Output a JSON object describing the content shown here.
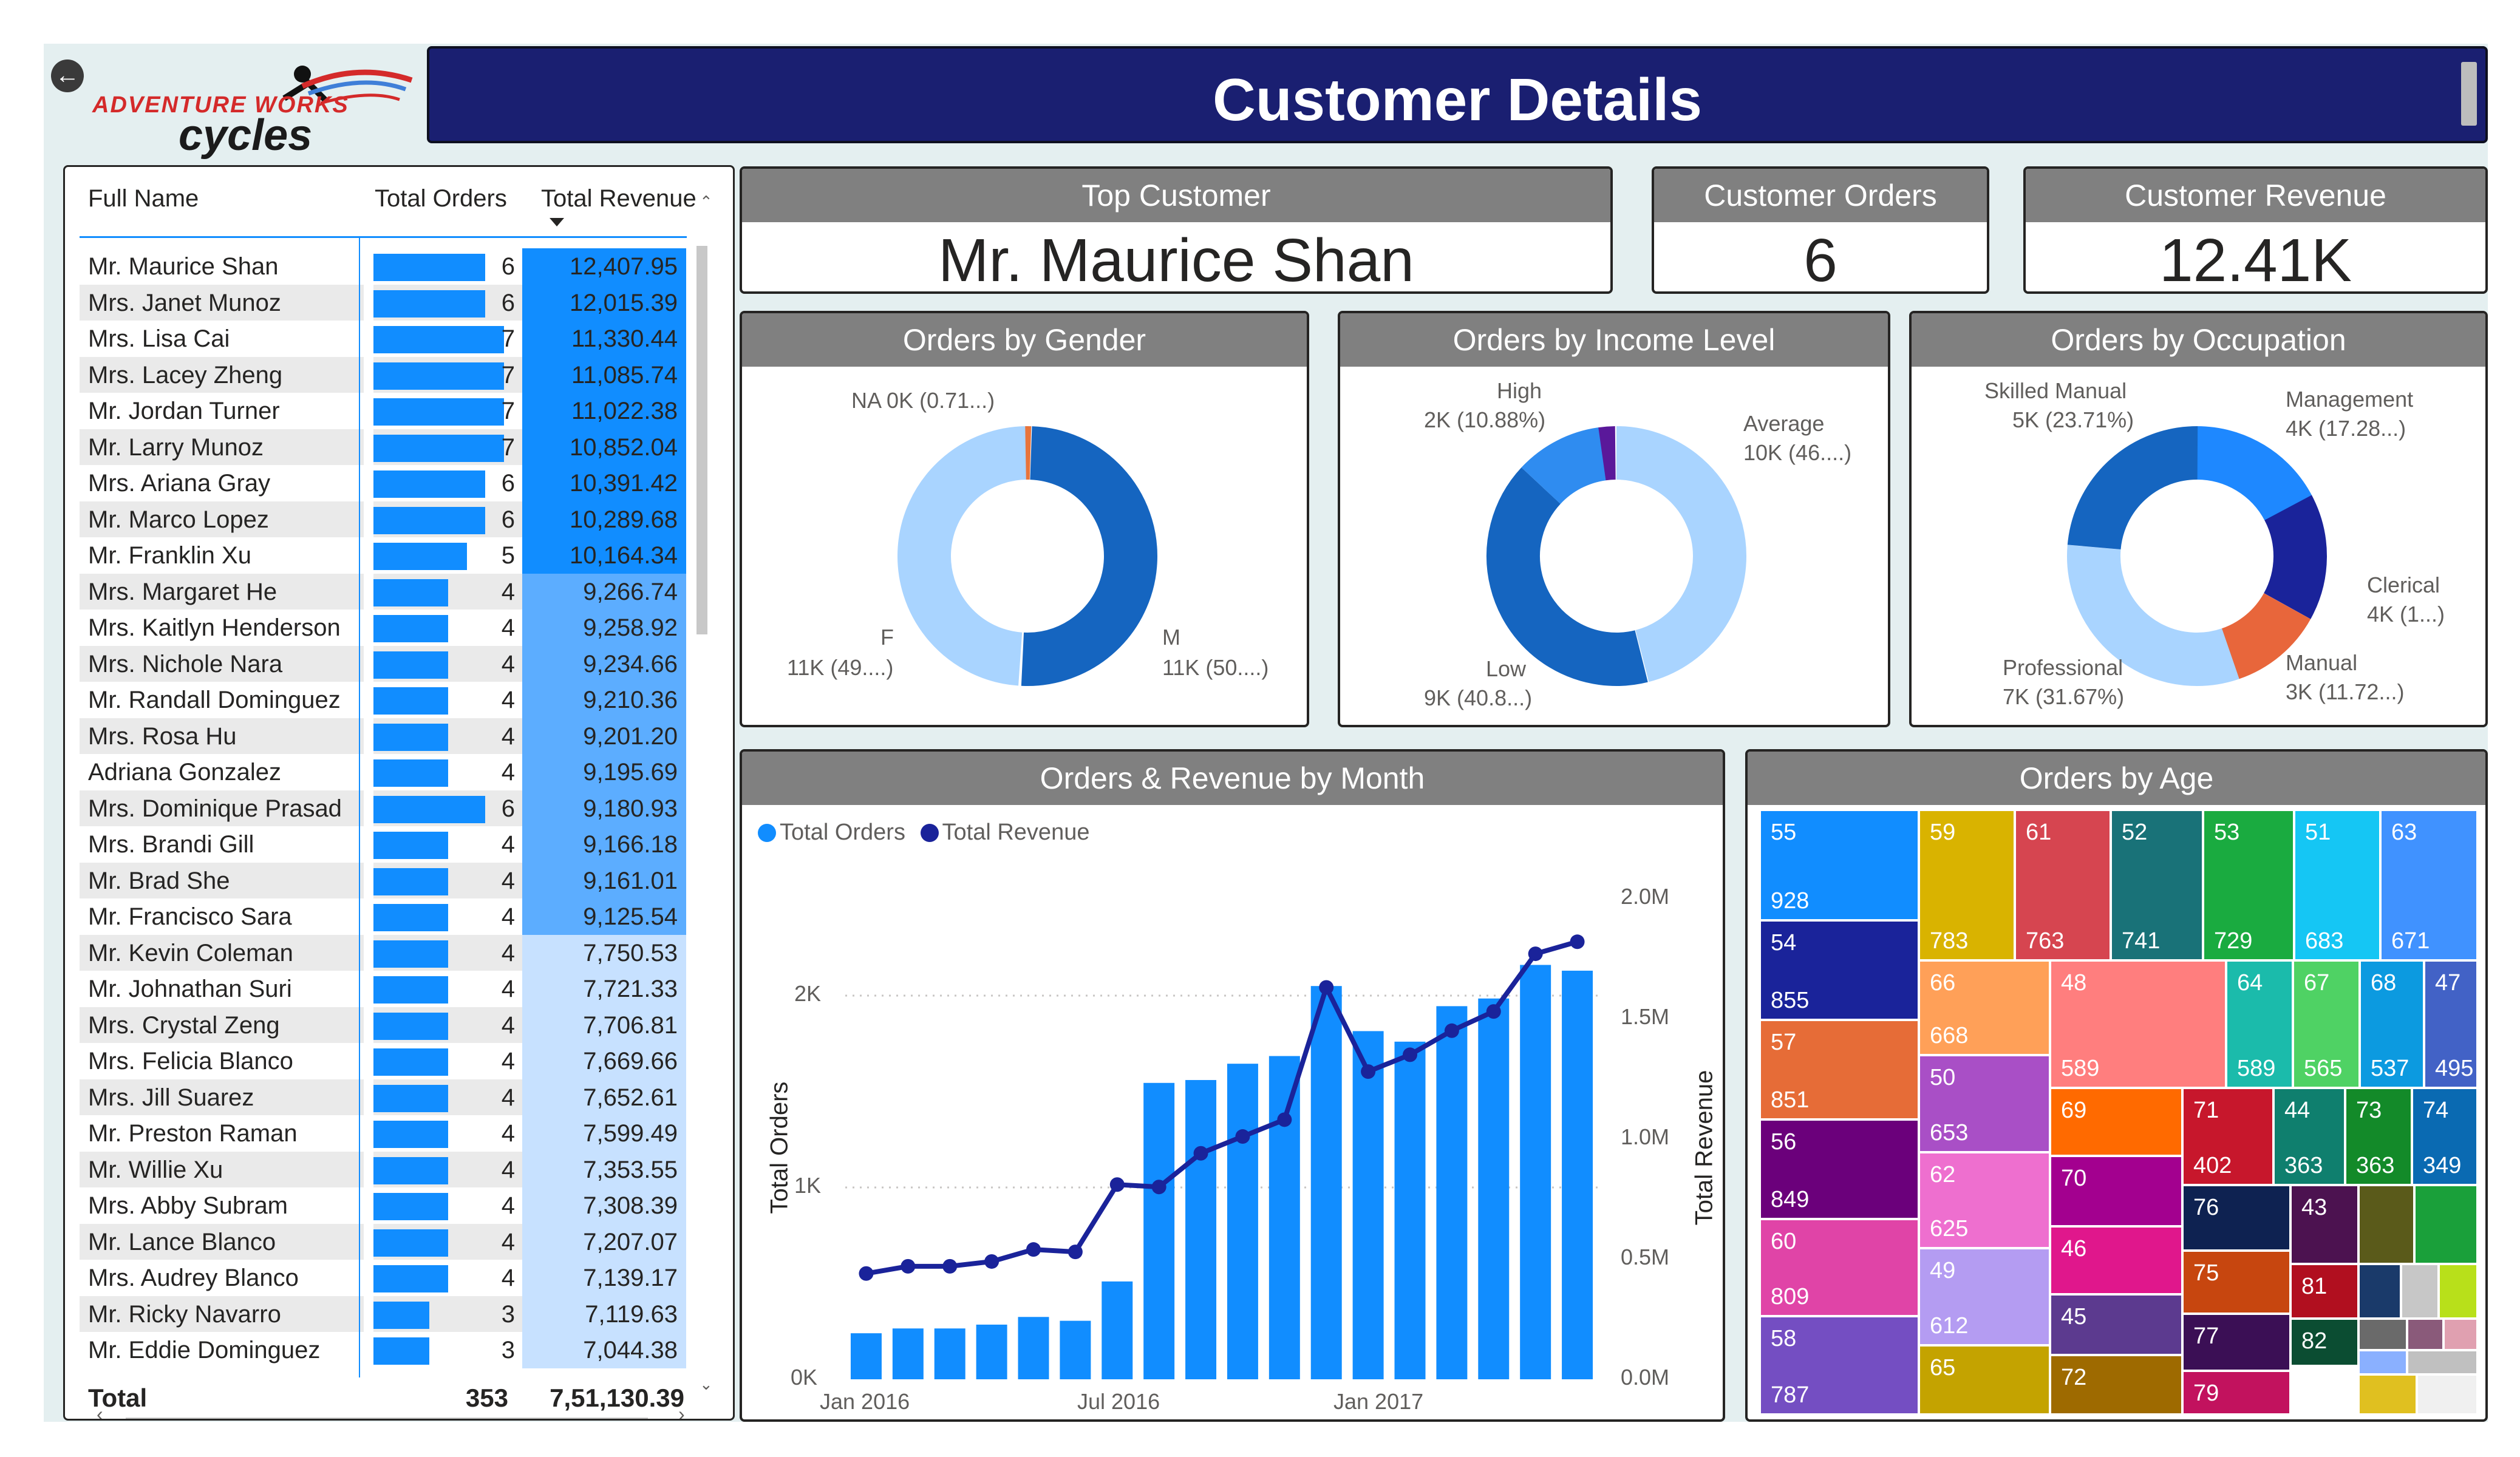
{
  "header": {
    "title": "Customer Details",
    "logo_small": "ADVENTURE WORKS",
    "logo_big": "cycles"
  },
  "table": {
    "columns": [
      "Full Name",
      "Total Orders",
      "Total Revenue"
    ],
    "rows": [
      {
        "name": "Mr. Maurice Shan",
        "orders": "6",
        "revenue": "12,407.95"
      },
      {
        "name": "Mrs. Janet Munoz",
        "orders": "6",
        "revenue": "12,015.39"
      },
      {
        "name": "Mrs. Lisa Cai",
        "orders": "7",
        "revenue": "11,330.44"
      },
      {
        "name": "Mrs. Lacey Zheng",
        "orders": "7",
        "revenue": "11,085.74"
      },
      {
        "name": "Mr. Jordan Turner",
        "orders": "7",
        "revenue": "11,022.38"
      },
      {
        "name": "Mr. Larry Munoz",
        "orders": "7",
        "revenue": "10,852.04"
      },
      {
        "name": "Mrs. Ariana Gray",
        "orders": "6",
        "revenue": "10,391.42"
      },
      {
        "name": "Mr. Marco Lopez",
        "orders": "6",
        "revenue": "10,289.68"
      },
      {
        "name": "Mr. Franklin Xu",
        "orders": "5",
        "revenue": "10,164.34"
      },
      {
        "name": "Mrs. Margaret He",
        "orders": "4",
        "revenue": "9,266.74"
      },
      {
        "name": "Mrs. Kaitlyn Henderson",
        "orders": "4",
        "revenue": "9,258.92"
      },
      {
        "name": "Mrs. Nichole Nara",
        "orders": "4",
        "revenue": "9,234.66"
      },
      {
        "name": "Mr. Randall Dominguez",
        "orders": "4",
        "revenue": "9,210.36"
      },
      {
        "name": "Mrs. Rosa Hu",
        "orders": "4",
        "revenue": "9,201.20"
      },
      {
        "name": "Adriana Gonzalez",
        "orders": "4",
        "revenue": "9,195.69"
      },
      {
        "name": "Mrs. Dominique Prasad",
        "orders": "6",
        "revenue": "9,180.93"
      },
      {
        "name": "Mrs. Brandi Gill",
        "orders": "4",
        "revenue": "9,166.18"
      },
      {
        "name": "Mr. Brad She",
        "orders": "4",
        "revenue": "9,161.01"
      },
      {
        "name": "Mr. Francisco Sara",
        "orders": "4",
        "revenue": "9,125.54"
      },
      {
        "name": "Mr. Kevin Coleman",
        "orders": "4",
        "revenue": "7,750.53"
      },
      {
        "name": "Mr. Johnathan Suri",
        "orders": "4",
        "revenue": "7,721.33"
      },
      {
        "name": "Mrs. Crystal Zeng",
        "orders": "4",
        "revenue": "7,706.81"
      },
      {
        "name": "Mrs. Felicia Blanco",
        "orders": "4",
        "revenue": "7,669.66"
      },
      {
        "name": "Mrs. Jill Suarez",
        "orders": "4",
        "revenue": "7,652.61"
      },
      {
        "name": "Mr. Preston Raman",
        "orders": "4",
        "revenue": "7,599.49"
      },
      {
        "name": "Mr. Willie Xu",
        "orders": "4",
        "revenue": "7,353.55"
      },
      {
        "name": "Mrs. Abby Subram",
        "orders": "4",
        "revenue": "7,308.39"
      },
      {
        "name": "Mr. Lance Blanco",
        "orders": "4",
        "revenue": "7,207.07"
      },
      {
        "name": "Mrs. Audrey Blanco",
        "orders": "4",
        "revenue": "7,139.17"
      },
      {
        "name": "Mr. Ricky Navarro",
        "orders": "3",
        "revenue": "7,119.63"
      },
      {
        "name": "Mr. Eddie Dominguez",
        "orders": "3",
        "revenue": "7,044.38"
      }
    ],
    "total_label": "Total",
    "total_orders": "353",
    "total_revenue": "7,51,130.39"
  },
  "kpis": {
    "top_customer": {
      "label": "Top Customer",
      "value": "Mr. Maurice Shan"
    },
    "orders": {
      "label": "Customer Orders",
      "value": "6"
    },
    "revenue": {
      "label": "Customer Revenue",
      "value": "12.41K"
    }
  },
  "gender": {
    "title": "Orders by Gender",
    "labels": {
      "na_name": "NA",
      "na_value": "0K (0.71...)",
      "f_name": "F",
      "f_value": "11K (49....)",
      "m_name": "M",
      "m_value": "11K (50....)"
    },
    "colors": {
      "M": "#1565c0",
      "F": "#a9d4ff",
      "NA": "#e8743b"
    }
  },
  "income": {
    "title": "Orders by Income Level",
    "labels": {
      "high_name": "High",
      "high_value": "2K (10.88%)",
      "avg_name": "Average",
      "avg_value": "10K (46....)",
      "low_name": "Low",
      "low_value": "9K (40.8...)"
    },
    "colors": {
      "Average": "#a9d4ff",
      "Low": "#1565c0",
      "High": "#2f8cf0",
      "Other": "#5a189a"
    }
  },
  "occupation": {
    "title": "Orders by Occupation",
    "labels": {
      "skilled_name": "Skilled Manual",
      "skilled_value": "5K (23.71%)",
      "mgmt_name": "Management",
      "mgmt_value": "4K (17.28...)",
      "cler_name": "Clerical",
      "cler_value": "4K (1...)",
      "man_name": "Manual",
      "man_value": "3K (11.72...)",
      "prof_name": "Professional",
      "prof_value": "7K (31.67%)"
    },
    "colors": {
      "Management": "#1e88ff",
      "Clerical": "#1a239a",
      "Manual": "#e8663b",
      "Professional": "#a9d4ff",
      "Skilled Manual": "#1565c0"
    }
  },
  "combo": {
    "title": "Orders & Revenue by Month",
    "legend": [
      "Total Orders",
      "Total Revenue"
    ],
    "y_left_label": "Total Orders",
    "y_right_label": "Total Revenue",
    "y_left_ticks": [
      "0K",
      "1K",
      "2K"
    ],
    "y_right_ticks": [
      "0.0M",
      "0.5M",
      "1.0M",
      "1.5M",
      "2.0M"
    ],
    "x_ticks": [
      "Jan 2016",
      "Jul 2016",
      "Jan 2017"
    ]
  },
  "chart_data": {
    "type": "bar",
    "title": "Orders & Revenue by Month",
    "categories": [
      "Jan 2016",
      "Feb 2016",
      "Mar 2016",
      "Apr 2016",
      "May 2016",
      "Jun 2016",
      "Jul 2016",
      "Aug 2016",
      "Sep 2016",
      "Oct 2016",
      "Nov 2016",
      "Dec 2016",
      "Jan 2017",
      "Feb 2017",
      "Mar 2017",
      "Apr 2017",
      "May 2017",
      "Jun 2017"
    ],
    "series": [
      {
        "name": "Total Orders",
        "axis": "left",
        "type": "bar",
        "values": [
          240,
          265,
          265,
          285,
          325,
          305,
          510,
          1545,
          1560,
          1645,
          1685,
          2050,
          1815,
          1760,
          1945,
          1985,
          2160,
          2130
        ]
      },
      {
        "name": "Total Revenue",
        "axis": "right",
        "type": "line",
        "values": [
          0.44,
          0.47,
          0.47,
          0.49,
          0.54,
          0.53,
          0.81,
          0.8,
          0.94,
          1.01,
          1.08,
          1.63,
          1.28,
          1.35,
          1.45,
          1.53,
          1.77,
          1.82
        ]
      }
    ],
    "ylim_left": [
      0,
      2300
    ],
    "ylim_right": [
      0,
      2.0
    ],
    "colors": {
      "Total Orders": "#118dff",
      "Total Revenue": "#1a239a"
    }
  },
  "age": {
    "title": "Orders by Age",
    "items": [
      {
        "age": "55",
        "value": "928",
        "color": "#118dff"
      },
      {
        "age": "54",
        "value": "855",
        "color": "#1a239a"
      },
      {
        "age": "57",
        "value": "851",
        "color": "#e66c37"
      },
      {
        "age": "56",
        "value": "849",
        "color": "#6b007b"
      },
      {
        "age": "60",
        "value": "809",
        "color": "#e044a7"
      },
      {
        "age": "58",
        "value": "787",
        "color": "#744ec2"
      },
      {
        "age": "59",
        "value": "783",
        "color": "#d9b300"
      },
      {
        "age": "61",
        "value": "763",
        "color": "#d64550"
      },
      {
        "age": "52",
        "value": "741",
        "color": "#197278"
      },
      {
        "age": "53",
        "value": "729",
        "color": "#1aab40"
      },
      {
        "age": "51",
        "value": "683",
        "color": "#15c6f4"
      },
      {
        "age": "63",
        "value": "671",
        "color": "#4092ff"
      },
      {
        "age": "66",
        "value": "668",
        "color": "#ffa058"
      },
      {
        "age": "48",
        "value": "589",
        "color": "#ff7e7e"
      },
      {
        "age": "64",
        "value": "589",
        "color": "#1bbbab"
      },
      {
        "age": "67",
        "value": "565",
        "color": "#4fd264"
      },
      {
        "age": "68",
        "value": "537",
        "color": "#0c9ae0"
      },
      {
        "age": "47",
        "value": "495",
        "color": "#4262c6"
      },
      {
        "age": "50",
        "value": "653",
        "color": "#a94fc6"
      },
      {
        "age": "62",
        "value": "625",
        "color": "#ee6fcf"
      },
      {
        "age": "49",
        "value": "612",
        "color": "#b49cf2"
      },
      {
        "age": "65",
        "value": "",
        "color": "#c4a300"
      },
      {
        "age": "69",
        "value": "",
        "color": "#ff6a00"
      },
      {
        "age": "71",
        "value": "402",
        "color": "#c7172c"
      },
      {
        "age": "44",
        "value": "363",
        "color": "#0f7f6e"
      },
      {
        "age": "73",
        "value": "363",
        "color": "#138a29"
      },
      {
        "age": "74",
        "value": "349",
        "color": "#0a6ab2"
      },
      {
        "age": "70",
        "value": "",
        "color": "#a3008f"
      },
      {
        "age": "46",
        "value": "",
        "color": "#e0178c"
      },
      {
        "age": "45",
        "value": "",
        "color": "#5c3a8f"
      },
      {
        "age": "72",
        "value": "",
        "color": "#9e6a00"
      },
      {
        "age": "76",
        "value": "",
        "color": "#0e2251"
      },
      {
        "age": "43",
        "value": "",
        "color": "#4c1250"
      },
      {
        "age": "75",
        "value": "",
        "color": "#c7460f"
      },
      {
        "age": "81",
        "value": "",
        "color": "#b10f1f"
      },
      {
        "age": "77",
        "value": "",
        "color": "#3b0f55"
      },
      {
        "age": "82",
        "value": "",
        "color": "#0b4d32"
      },
      {
        "age": "79",
        "value": "",
        "color": "#c2125e"
      }
    ]
  }
}
